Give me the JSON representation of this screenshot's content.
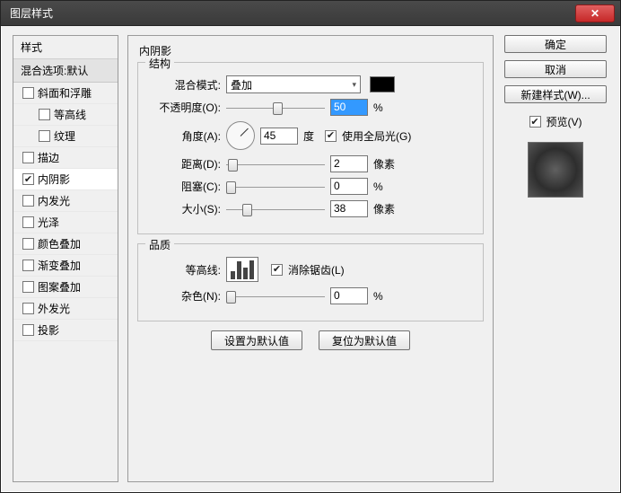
{
  "window": {
    "title": "图层样式"
  },
  "left": {
    "header": "样式",
    "sub": "混合选项:默认",
    "items": [
      {
        "label": "斜面和浮雕",
        "checked": false,
        "indent": false
      },
      {
        "label": "等高线",
        "checked": false,
        "indent": true
      },
      {
        "label": "纹理",
        "checked": false,
        "indent": true
      },
      {
        "label": "描边",
        "checked": false,
        "indent": false
      },
      {
        "label": "内阴影",
        "checked": true,
        "indent": false,
        "selected": true
      },
      {
        "label": "内发光",
        "checked": false,
        "indent": false
      },
      {
        "label": "光泽",
        "checked": false,
        "indent": false
      },
      {
        "label": "颜色叠加",
        "checked": false,
        "indent": false
      },
      {
        "label": "渐变叠加",
        "checked": false,
        "indent": false
      },
      {
        "label": "图案叠加",
        "checked": false,
        "indent": false
      },
      {
        "label": "外发光",
        "checked": false,
        "indent": false
      },
      {
        "label": "投影",
        "checked": false,
        "indent": false
      }
    ]
  },
  "mid": {
    "title": "内阴影",
    "structure": {
      "legend": "结构",
      "blend_label": "混合模式:",
      "blend_value": "叠加",
      "opacity_label": "不透明度(O):",
      "opacity_value": "50",
      "opacity_unit": "%",
      "angle_label": "角度(A):",
      "angle_value": "45",
      "angle_unit": "度",
      "global_label": "使用全局光(G)",
      "global_checked": true,
      "distance_label": "距离(D):",
      "distance_value": "2",
      "distance_unit": "像素",
      "choke_label": "阻塞(C):",
      "choke_value": "0",
      "choke_unit": "%",
      "size_label": "大小(S):",
      "size_value": "38",
      "size_unit": "像素",
      "swatch_color": "#000000"
    },
    "quality": {
      "legend": "品质",
      "contour_label": "等高线:",
      "antialias_label": "消除锯齿(L)",
      "antialias_checked": true,
      "noise_label": "杂色(N):",
      "noise_value": "0",
      "noise_unit": "%"
    },
    "defaults_set": "设置为默认值",
    "defaults_reset": "复位为默认值"
  },
  "right": {
    "ok": "确定",
    "cancel": "取消",
    "newstyle": "新建样式(W)...",
    "preview_label": "预览(V)",
    "preview_checked": true
  }
}
